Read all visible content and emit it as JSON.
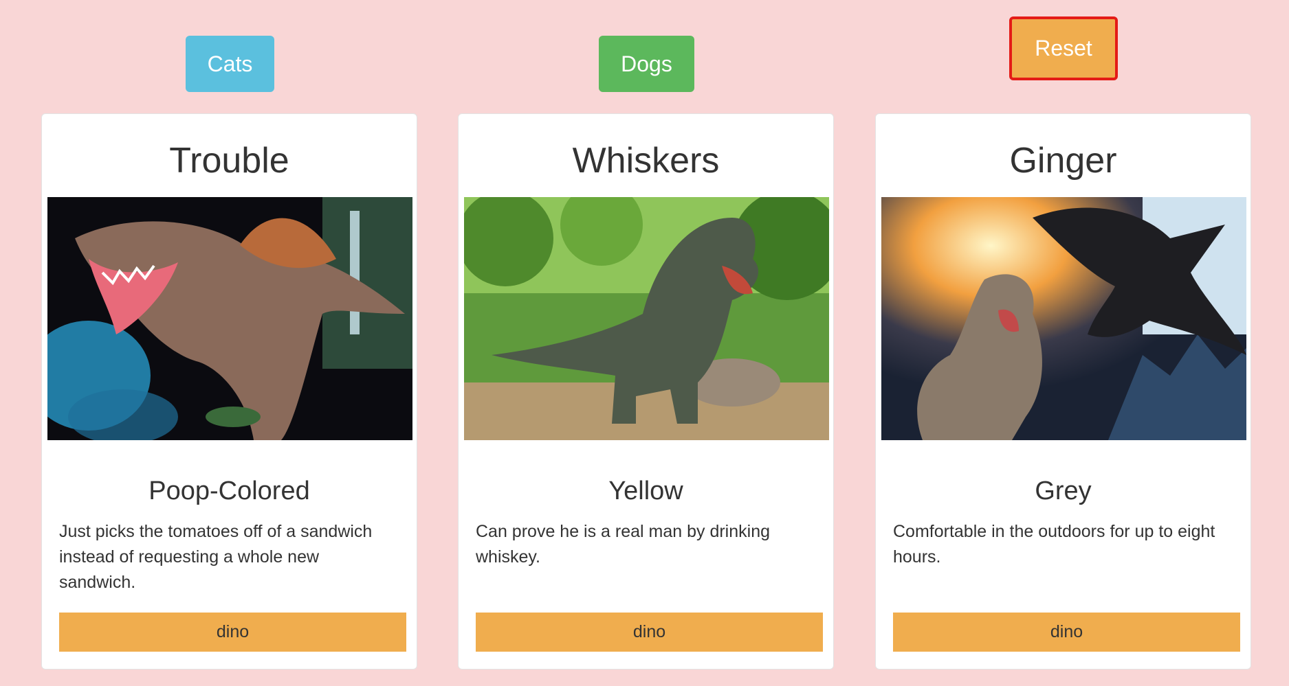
{
  "buttons": {
    "cats": "Cats",
    "dogs": "Dogs",
    "reset": "Reset"
  },
  "colors": {
    "background": "#f9d6d6",
    "cats": "#5bc0de",
    "dogs": "#5cb85c",
    "reset": "#f0ad4e",
    "reset_border": "#e41b17",
    "action": "#f0ad4e"
  },
  "cards": [
    {
      "name": "Trouble",
      "image": "dinosaur-photo-spinosaurus",
      "color": "Poop-Colored",
      "description": "Just picks the tomatoes off of a sandwich instead of requesting a whole new sandwich.",
      "action": "dino"
    },
    {
      "name": "Whiskers",
      "image": "dinosaur-photo-trex-forest",
      "color": "Yellow",
      "description": "Can prove he is a real man by drinking whiskey.",
      "action": "dino"
    },
    {
      "name": "Ginger",
      "image": "dinosaur-photo-trex-pterodactyl",
      "color": "Grey",
      "description": "Comfortable in the outdoors for up to eight hours.",
      "action": "dino"
    }
  ]
}
